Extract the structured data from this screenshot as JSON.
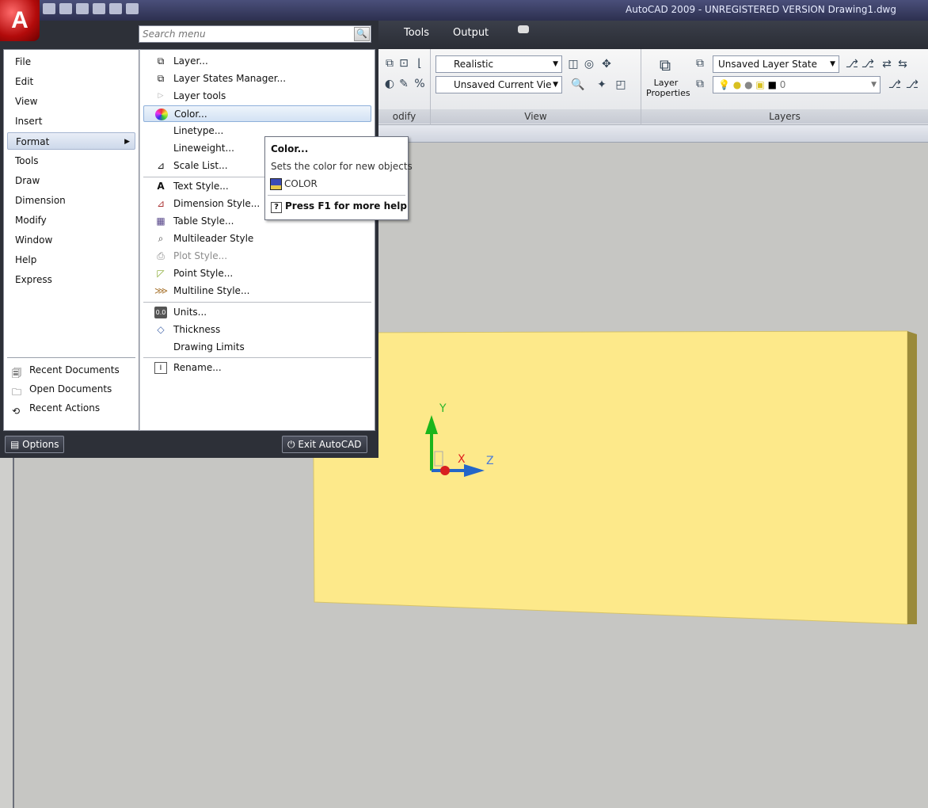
{
  "window": {
    "title": "AutoCAD 2009 - UNREGISTERED VERSION Drawing1.dwg"
  },
  "app_button": {
    "letter": "A"
  },
  "tabs": [
    "Tools",
    "Output"
  ],
  "search": {
    "placeholder": "Search menu"
  },
  "menu_left": {
    "items": [
      "File",
      "Edit",
      "View",
      "Insert",
      "Format",
      "Tools",
      "Draw",
      "Dimension",
      "Modify",
      "Window",
      "Help",
      "Express"
    ],
    "selected": "Format",
    "recent": [
      "Recent Documents",
      "Open Documents",
      "Recent Actions"
    ]
  },
  "menu_right": {
    "items": [
      {
        "label": "Layer...",
        "icon": "layer-icon"
      },
      {
        "label": "Layer States Manager...",
        "icon": "layer-states-icon"
      },
      {
        "label": "Layer tools",
        "icon": "submenu-arrow-icon"
      },
      {
        "label": "Color...",
        "icon": "color-wheel-icon"
      },
      {
        "label": "Linetype...",
        "icon": ""
      },
      {
        "label": "Lineweight...",
        "icon": ""
      },
      {
        "label": "Scale List...",
        "icon": "scale-list-icon"
      },
      {
        "label": "Text Style...",
        "icon": "text-style-icon"
      },
      {
        "label": "Dimension Style...",
        "icon": "dimension-style-icon"
      },
      {
        "label": "Table Style...",
        "icon": "table-style-icon"
      },
      {
        "label": "Multileader Style",
        "icon": "multileader-style-icon"
      },
      {
        "label": "Plot Style...",
        "icon": "plot-style-icon"
      },
      {
        "label": "Point Style...",
        "icon": "point-style-icon"
      },
      {
        "label": "Multiline Style...",
        "icon": "multiline-style-icon"
      },
      {
        "label": "Units...",
        "icon": "units-icon"
      },
      {
        "label": "Thickness",
        "icon": "thickness-icon"
      },
      {
        "label": "Drawing Limits",
        "icon": ""
      },
      {
        "label": "Rename...",
        "icon": "rename-icon"
      }
    ]
  },
  "bottom": {
    "options": "Options",
    "exit": "Exit AutoCAD"
  },
  "tooltip": {
    "title": "Color...",
    "description": "Sets the color for new objects",
    "command": "COLOR",
    "help": "Press F1 for more help"
  },
  "ribbon": {
    "visual_style": "Realistic",
    "view": "Unsaved Current Vie",
    "layer_state": "Unsaved Layer State",
    "layer_current": "0",
    "layer_properties": "Layer Properties",
    "groups": [
      "odify",
      "View",
      "Layers"
    ]
  },
  "ucs": {
    "x": "X",
    "y": "Y",
    "z": "Z"
  },
  "colors": {
    "solid_face": "#fde98a",
    "solid_edge": "#9a8a3a",
    "viewport": "#c6c6c3",
    "menu_bg": "#2d3038"
  }
}
